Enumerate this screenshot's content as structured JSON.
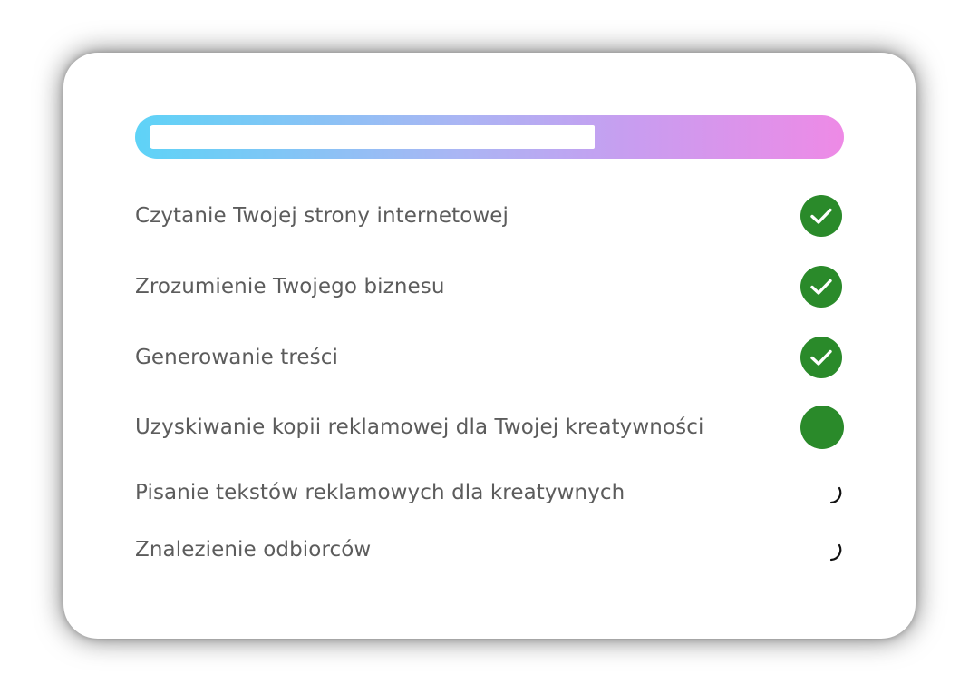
{
  "progress": {
    "value": 0.655
  },
  "steps": [
    {
      "label": "Czytanie Twojej strony internetowej",
      "status": "completed",
      "icon": "check-icon"
    },
    {
      "label": "Zrozumienie Twojego biznesu",
      "status": "completed",
      "icon": "check-icon"
    },
    {
      "label": "Generowanie treści",
      "status": "completed",
      "icon": "check-icon"
    },
    {
      "label": "Uzyskiwanie kopii reklamowej dla Twojej kreatywności",
      "status": "in-progress",
      "icon": "status-dot-icon"
    },
    {
      "label": "Pisanie tekstów reklamowych dla kreatywnych",
      "status": "pending",
      "icon": "loading-spinner-icon"
    },
    {
      "label": "Znalezienie odbiorców",
      "status": "pending",
      "icon": "loading-spinner-icon"
    }
  ],
  "colors": {
    "done": "#2a8a2a",
    "label": "#5c5c5c",
    "gradient_start": "#5ed3f7",
    "gradient_end": "#ee8ae6"
  }
}
